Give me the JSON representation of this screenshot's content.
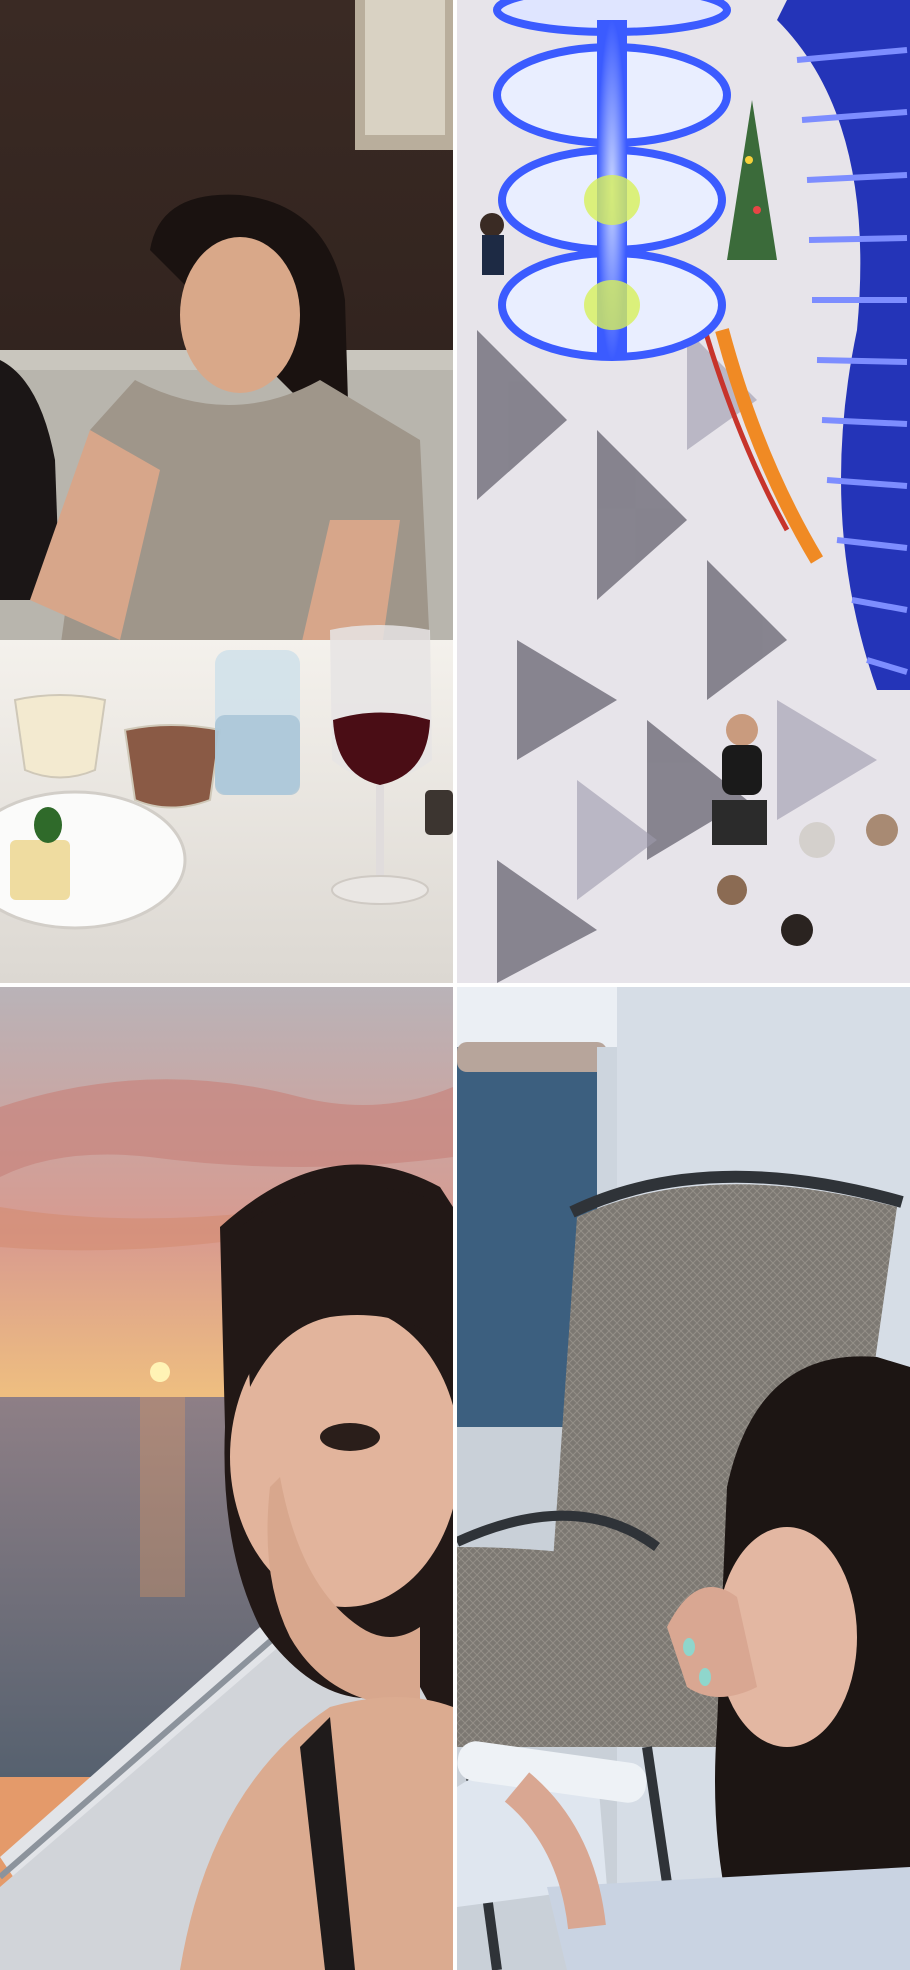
{
  "collage": {
    "layout": "2x2 grid",
    "photos": [
      {
        "id": "dinner-portrait"
      },
      {
        "id": "atrium-chandelier"
      },
      {
        "id": "sunset-selfie"
      },
      {
        "id": "balcony-morning"
      }
    ]
  },
  "colors": {
    "divider": "#ffffff",
    "chandelier_blue": "#3b5bff",
    "sunset_orange": "#f3a25a"
  }
}
